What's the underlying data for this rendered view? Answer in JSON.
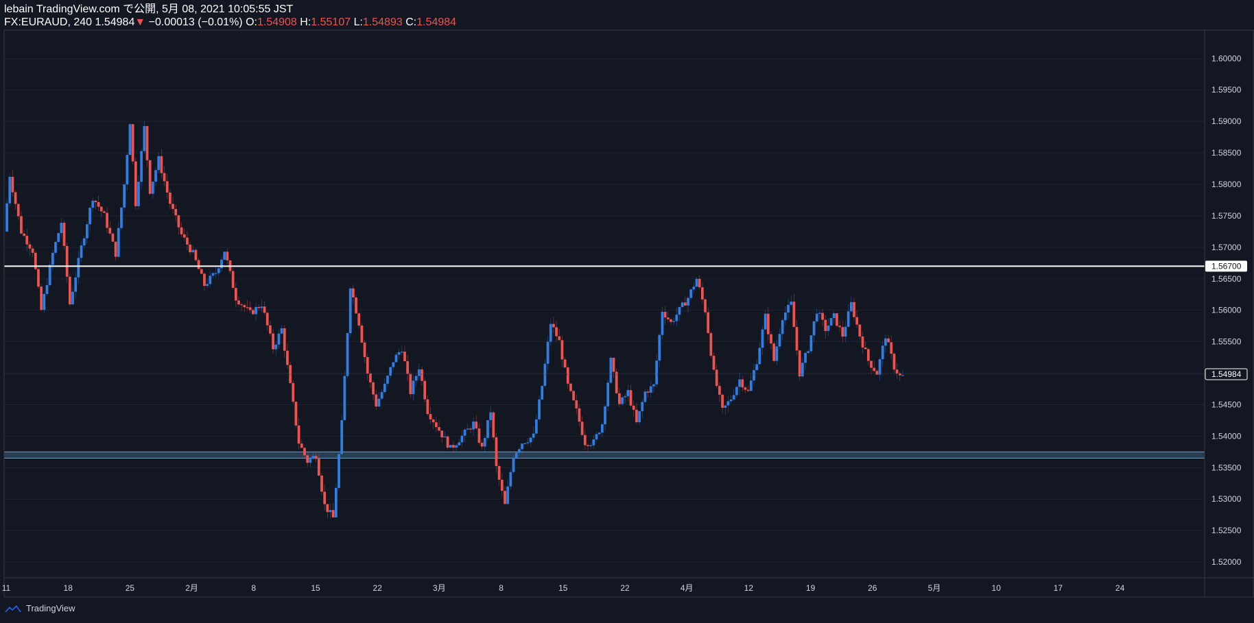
{
  "header": {
    "line1": "lebain TradingView.com で公開, 5月 08, 2021 10:05:55 JST",
    "symbol": "FX:EURAUD, 240",
    "last": "1.54984",
    "change_arrow": "▼",
    "change": "−0.00013 (−0.01%)",
    "o_label": "O:",
    "o_val": "1.54908",
    "h_label": "H:",
    "h_val": "1.55107",
    "l_label": "L:",
    "l_val": "1.54893",
    "c_label": "C:",
    "c_val": "1.54984"
  },
  "footer": {
    "brand": "TradingView"
  },
  "colors": {
    "background": "#131722",
    "up": "#2e7ee6",
    "down": "#ef5350",
    "grid": "#1f2330",
    "axis_text": "#d1d4dc",
    "hline": "#ffffff",
    "zone_fill": "#2a3f55",
    "zone_border": "#7fa6c9"
  },
  "chart_data": {
    "type": "candlestick",
    "ylim": [
      1.5175,
      1.6045
    ],
    "y_ticks": [
      "1.52000",
      "1.52500",
      "1.53000",
      "1.53500",
      "1.54000",
      "1.54500",
      "1.55000",
      "1.55500",
      "1.56000",
      "1.56500",
      "1.57000",
      "1.57500",
      "1.58000",
      "1.58500",
      "1.59000",
      "1.59500",
      "1.60000"
    ],
    "x_ticks": [
      "11",
      "18",
      "25",
      "2月",
      "8",
      "15",
      "22",
      "3月",
      "8",
      "15",
      "22",
      "4月",
      "12",
      "19",
      "26",
      "5月",
      "10",
      "17",
      "24"
    ],
    "last_price_label": "1.54984",
    "horizontal_line": {
      "value": 1.567,
      "label": "1.56700"
    },
    "support_zone": [
      1.5365,
      1.5375
    ],
    "trend_anchors": [
      [
        0,
        1.5725
      ],
      [
        2,
        1.5815
      ],
      [
        6,
        1.5725
      ],
      [
        10,
        1.5695
      ],
      [
        13,
        1.56
      ],
      [
        17,
        1.569
      ],
      [
        20,
        1.574
      ],
      [
        23,
        1.561
      ],
      [
        27,
        1.57
      ],
      [
        31,
        1.578
      ],
      [
        35,
        1.575
      ],
      [
        39,
        1.569
      ],
      [
        42,
        1.58
      ],
      [
        44,
        1.59
      ],
      [
        46,
        1.577
      ],
      [
        49,
        1.589
      ],
      [
        51,
        1.579
      ],
      [
        54,
        1.584
      ],
      [
        58,
        1.577
      ],
      [
        62,
        1.572
      ],
      [
        66,
        1.569
      ],
      [
        70,
        1.564
      ],
      [
        74,
        1.566
      ],
      [
        77,
        1.5695
      ],
      [
        81,
        1.562
      ],
      [
        86,
        1.5595
      ],
      [
        90,
        1.561
      ],
      [
        94,
        1.554
      ],
      [
        97,
        1.557
      ],
      [
        100,
        1.548
      ],
      [
        103,
        1.539
      ],
      [
        106,
        1.536
      ],
      [
        109,
        1.537
      ],
      [
        112,
        1.529
      ],
      [
        115,
        1.527
      ],
      [
        118,
        1.542
      ],
      [
        121,
        1.564
      ],
      [
        124,
        1.558
      ],
      [
        127,
        1.55
      ],
      [
        130,
        1.545
      ],
      [
        133,
        1.548
      ],
      [
        136,
        1.552
      ],
      [
        139,
        1.554
      ],
      [
        142,
        1.547
      ],
      [
        145,
        1.551
      ],
      [
        148,
        1.544
      ],
      [
        152,
        1.541
      ],
      [
        156,
        1.538
      ],
      [
        160,
        1.54
      ],
      [
        164,
        1.542
      ],
      [
        167,
        1.538
      ],
      [
        170,
        1.544
      ],
      [
        172,
        1.535
      ],
      [
        175,
        1.529
      ],
      [
        178,
        1.537
      ],
      [
        181,
        1.539
      ],
      [
        185,
        1.54
      ],
      [
        188,
        1.548
      ],
      [
        191,
        1.558
      ],
      [
        194,
        1.555
      ],
      [
        197,
        1.548
      ],
      [
        200,
        1.544
      ],
      [
        203,
        1.539
      ],
      [
        206,
        1.539
      ],
      [
        209,
        1.542
      ],
      [
        212,
        1.552
      ],
      [
        215,
        1.545
      ],
      [
        218,
        1.547
      ],
      [
        221,
        1.542
      ],
      [
        224,
        1.547
      ],
      [
        227,
        1.548
      ],
      [
        230,
        1.56
      ],
      [
        233,
        1.558
      ],
      [
        236,
        1.56
      ],
      [
        239,
        1.562
      ],
      [
        242,
        1.565
      ],
      [
        245,
        1.56
      ],
      [
        248,
        1.55
      ],
      [
        251,
        1.544
      ],
      [
        254,
        1.546
      ],
      [
        257,
        1.549
      ],
      [
        260,
        1.547
      ],
      [
        263,
        1.552
      ],
      [
        266,
        1.559
      ],
      [
        269,
        1.552
      ],
      [
        272,
        1.559
      ],
      [
        275,
        1.561
      ],
      [
        278,
        1.55
      ],
      [
        281,
        1.554
      ],
      [
        284,
        1.56
      ],
      [
        287,
        1.557
      ],
      [
        290,
        1.559
      ],
      [
        293,
        1.556
      ],
      [
        296,
        1.561
      ],
      [
        299,
        1.556
      ],
      [
        302,
        1.552
      ],
      [
        305,
        1.55
      ],
      [
        308,
        1.556
      ],
      [
        311,
        1.551
      ],
      [
        313,
        1.5495
      ]
    ],
    "candle_count": 314
  }
}
